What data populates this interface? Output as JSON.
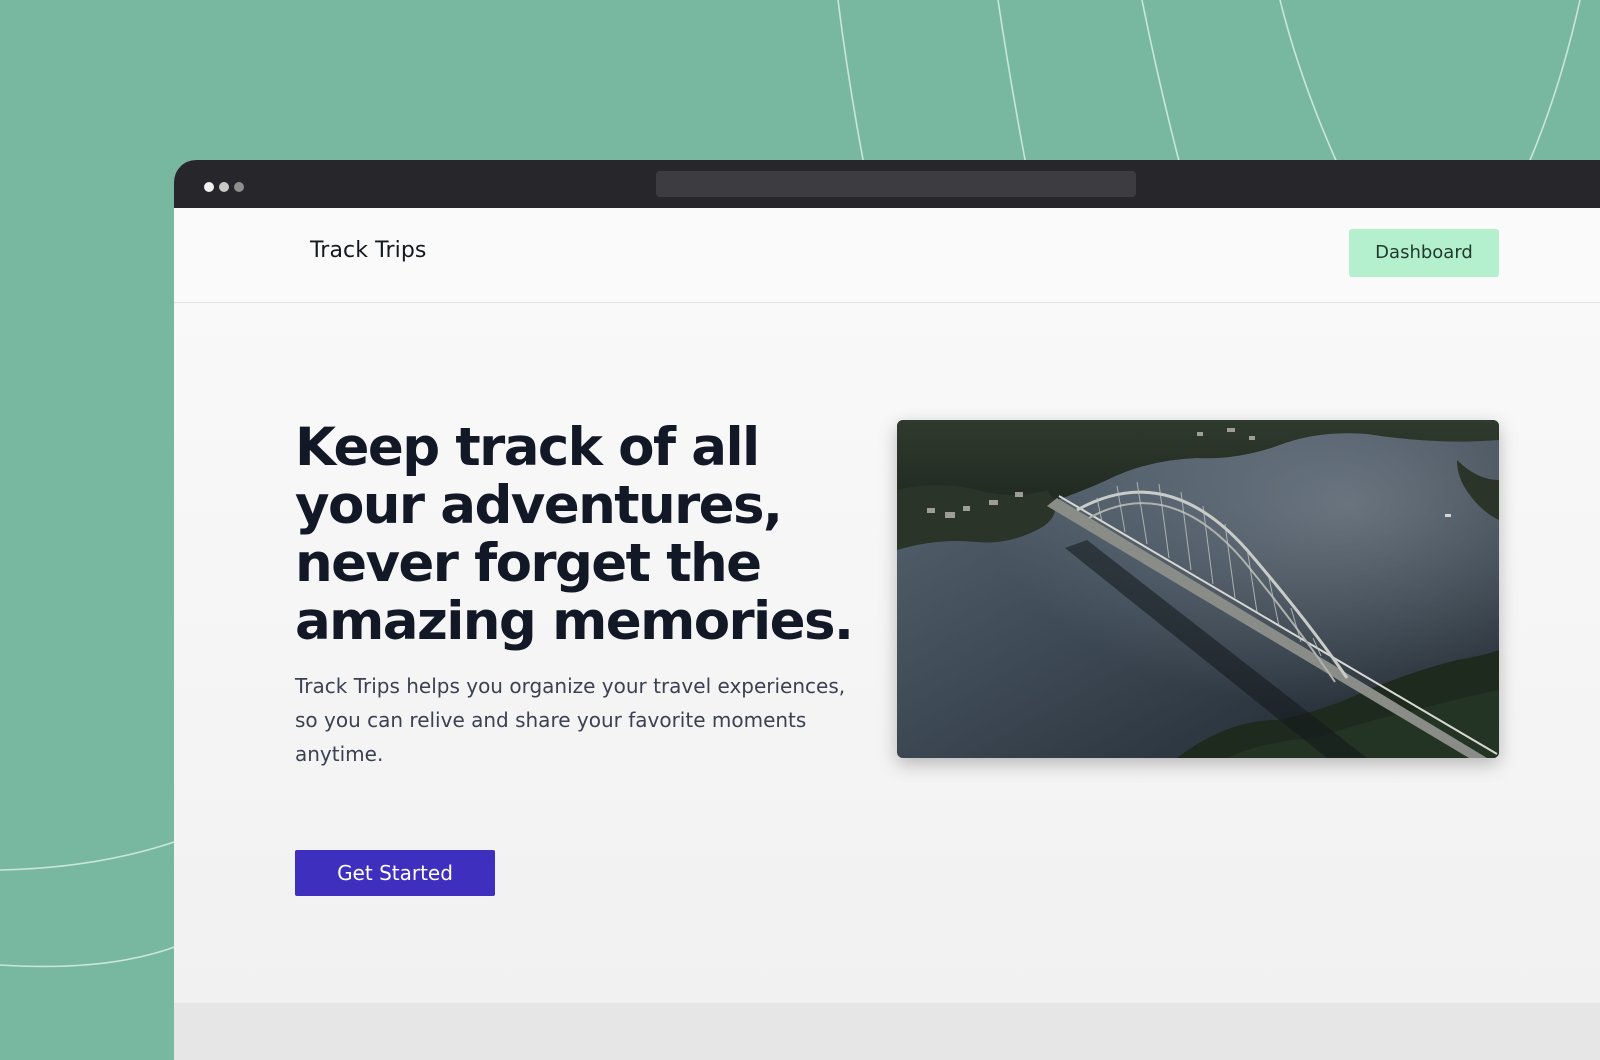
{
  "app": {
    "brand": "Track Trips",
    "dashboard_label": "Dashboard"
  },
  "hero": {
    "headline": "Keep track of all your adventures, never forget the amazing memories.",
    "subtext_line1": "Track Trips helps you organize your travel experiences,",
    "subtext_line2": "so you can relive and share your favorite moments anytime.",
    "cta_label": "Get Started",
    "image_icon": "bridge-photo"
  },
  "colors": {
    "background": "#79b8a0",
    "browser_chrome": "#27262b",
    "dashboard_button": "#b4f0cd",
    "cta_button": "#3f2fbf",
    "headline": "#121826"
  }
}
